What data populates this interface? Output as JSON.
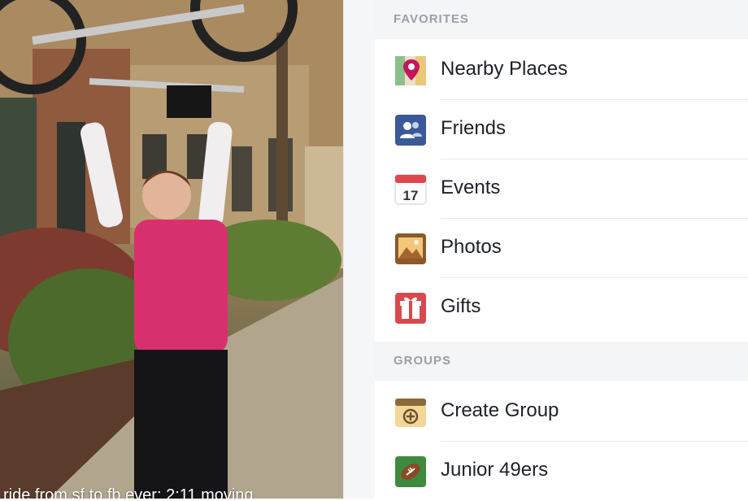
{
  "photo": {
    "caption": "ride from sf to fb ever: 2:11 moving"
  },
  "sections": [
    {
      "header": "FAVORITES",
      "items": [
        {
          "label": "Nearby Places",
          "icon": "map-pin-icon"
        },
        {
          "label": "Friends",
          "icon": "friends-icon"
        },
        {
          "label": "Events",
          "icon": "calendar-icon",
          "badge": "17"
        },
        {
          "label": "Photos",
          "icon": "photos-icon"
        },
        {
          "label": "Gifts",
          "icon": "gift-icon"
        }
      ]
    },
    {
      "header": "GROUPS",
      "items": [
        {
          "label": "Create Group",
          "icon": "create-group-icon"
        },
        {
          "label": "Junior 49ers",
          "icon": "football-icon"
        }
      ]
    }
  ],
  "colors": {
    "section_header_bg": "#f4f5f7",
    "section_header_text": "#9aa0aa",
    "label_text": "#1d2129",
    "facebook_blue": "#3b5998"
  }
}
